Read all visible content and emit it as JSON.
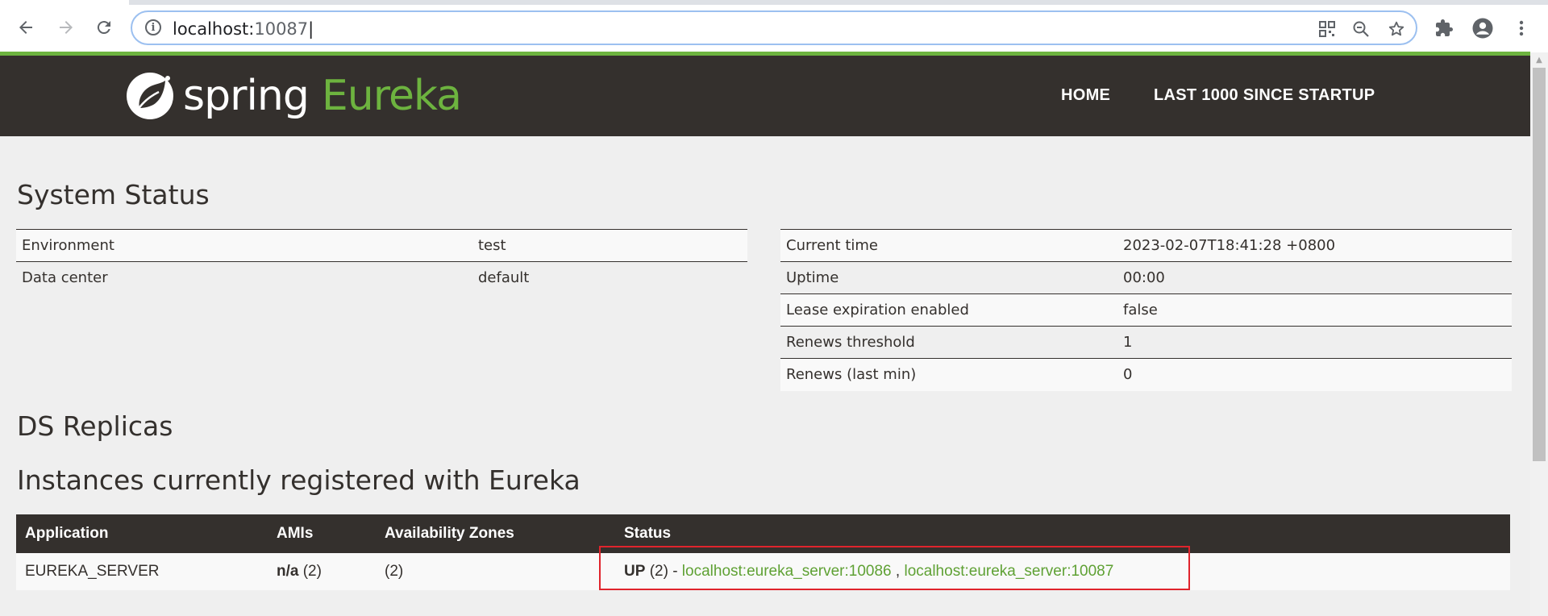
{
  "browser": {
    "url_host": "localhost:",
    "url_port": "10087",
    "back_icon": "arrow-left-icon",
    "forward_icon": "arrow-right-icon",
    "reload_icon": "reload-icon",
    "info_icon": "info-icon",
    "qr_icon": "qr-code-icon",
    "zoom_icon": "zoom-out-icon",
    "star_icon": "star-icon",
    "extensions_icon": "puzzle-icon",
    "profile_icon": "account-icon",
    "menu_icon": "kebab-menu-icon"
  },
  "header": {
    "logo_spring": "spring",
    "logo_eureka": "Eureka",
    "nav_home": "HOME",
    "nav_last1000": "LAST 1000 SINCE STARTUP",
    "colors": {
      "bar": "#34302d",
      "accent": "#6db33f"
    }
  },
  "system_status": {
    "title": "System Status",
    "left_rows": [
      {
        "key": "Environment",
        "value": "test"
      },
      {
        "key": "Data center",
        "value": "default"
      }
    ],
    "right_rows": [
      {
        "key": "Current time",
        "value": "2023-02-07T18:41:28 +0800"
      },
      {
        "key": "Uptime",
        "value": "00:00"
      },
      {
        "key": "Lease expiration enabled",
        "value": "false"
      },
      {
        "key": "Renews threshold",
        "value": "1"
      },
      {
        "key": "Renews (last min)",
        "value": "0"
      }
    ]
  },
  "ds_replicas": {
    "title": "DS Replicas"
  },
  "instances": {
    "title": "Instances currently registered with Eureka",
    "headers": [
      "Application",
      "AMIs",
      "Availability Zones",
      "Status"
    ],
    "rows": [
      {
        "application": "EUREKA_SERVER",
        "amis_bold": "n/a",
        "amis_count": "(2)",
        "zones": "(2)",
        "status_bold": "UP",
        "status_count": "(2) -",
        "link1": "localhost:eureka_server:10086",
        "separator": ",",
        "link2": "localhost:eureka_server:10087"
      }
    ]
  }
}
